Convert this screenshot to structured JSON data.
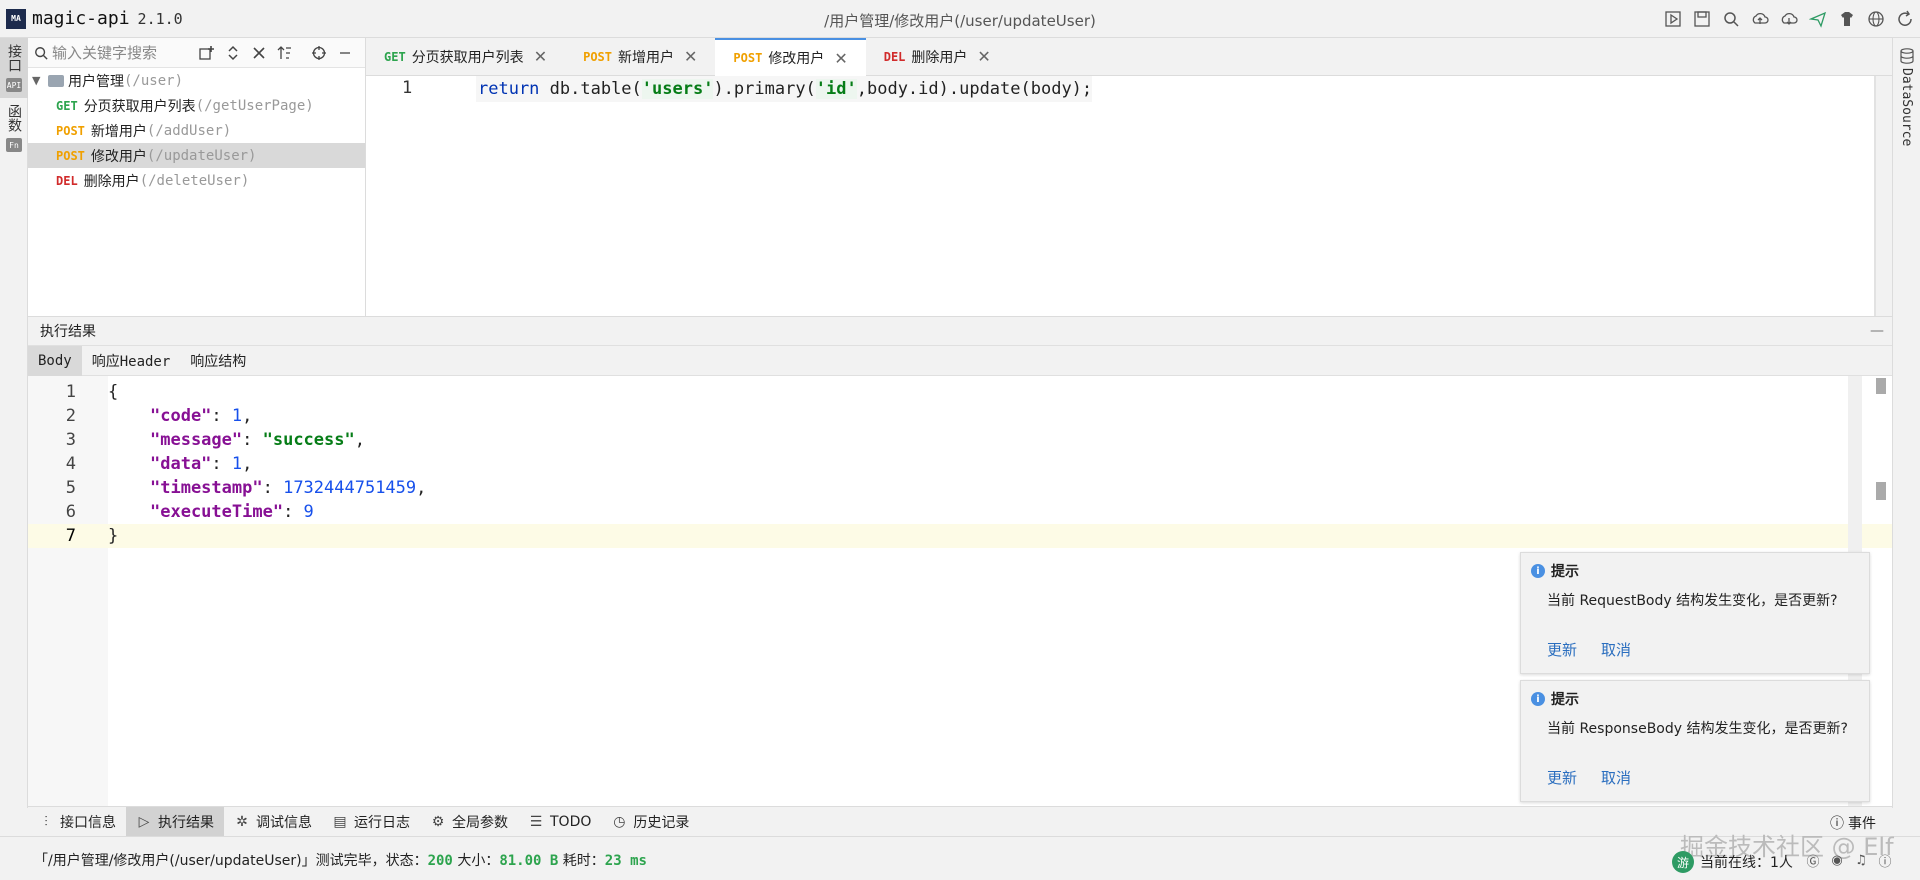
{
  "app": {
    "logo_text": "MA",
    "name": "magic-api",
    "version": "2.1.0",
    "title_path": "/用户管理/修改用户(/user/updateUser)"
  },
  "title_icons": [
    "run-icon",
    "save-icon",
    "search-icon",
    "upload-icon",
    "download-icon",
    "send-icon",
    "skin-icon",
    "globe-icon",
    "refresh-icon"
  ],
  "left_tabs": [
    {
      "label": "接口",
      "badge": "API"
    },
    {
      "label": "函数",
      "badge": "Fn"
    }
  ],
  "tree": {
    "search_placeholder": "输入关键字搜索",
    "group": {
      "name": "用户管理",
      "path": "(/user)"
    },
    "items": [
      {
        "method": "GET",
        "name": "分页获取用户列表",
        "path": "(/getUserPage)"
      },
      {
        "method": "POST",
        "name": "新增用户",
        "path": "(/addUser)"
      },
      {
        "method": "POST",
        "name": "修改用户",
        "path": "(/updateUser)"
      },
      {
        "method": "DEL",
        "name": "删除用户",
        "path": "(/deleteUser)"
      }
    ]
  },
  "editor_tabs": [
    {
      "method": "GET",
      "name": "分页获取用户列表"
    },
    {
      "method": "POST",
      "name": "新增用户"
    },
    {
      "method": "POST",
      "name": "修改用户"
    },
    {
      "method": "DEL",
      "name": "删除用户"
    }
  ],
  "editor": {
    "line_number": "1",
    "code": {
      "kw": "return",
      "p1": " db.table(",
      "s1": "'users'",
      "p2": ").primary(",
      "s2": "'id'",
      "p3": ",body.id).update(body);"
    }
  },
  "right_panel": {
    "label": "DataSource"
  },
  "result": {
    "title": "执行结果",
    "minimize": "—",
    "tabs": [
      "Body",
      "响应Header",
      "响应结构"
    ],
    "json_lines": [
      {
        "n": "1",
        "open": "{"
      },
      {
        "n": "2",
        "key": "\"code\"",
        "sep": ": ",
        "num": "1",
        "end": ","
      },
      {
        "n": "3",
        "key": "\"message\"",
        "sep": ": ",
        "str": "\"success\"",
        "end": ","
      },
      {
        "n": "4",
        "key": "\"data\"",
        "sep": ": ",
        "num": "1",
        "end": ","
      },
      {
        "n": "5",
        "key": "\"timestamp\"",
        "sep": ": ",
        "num": "1732444751459",
        "end": ","
      },
      {
        "n": "6",
        "key": "\"executeTime\"",
        "sep": ": ",
        "num": "9",
        "end": ""
      },
      {
        "n": "7",
        "open": "}"
      }
    ]
  },
  "notices": [
    {
      "title": "提示",
      "body": "当前 RequestBody 结构发生变化，是否更新?",
      "update": "更新",
      "cancel": "取消"
    },
    {
      "title": "提示",
      "body": "当前 ResponseBody 结构发生变化，是否更新?",
      "update": "更新",
      "cancel": "取消"
    }
  ],
  "tool_tabs": [
    {
      "icon": "interface-info-icon",
      "glyph": "⫶",
      "label": "接口信息"
    },
    {
      "icon": "play-icon",
      "glyph": "▷",
      "label": "执行结果"
    },
    {
      "icon": "bug-icon",
      "glyph": "✲",
      "label": "调试信息"
    },
    {
      "icon": "log-icon",
      "glyph": "▤",
      "label": "运行日志"
    },
    {
      "icon": "gear-icon",
      "glyph": "⚙",
      "label": "全局参数"
    },
    {
      "icon": "list-icon",
      "glyph": "☰",
      "label": "TODO"
    },
    {
      "icon": "clock-icon",
      "glyph": "◷",
      "label": "历史记录"
    }
  ],
  "events_label": "事件",
  "status": {
    "prefix": "「/用户管理/修改用户(/user/updateUser)」测试完毕，状态：",
    "status_code": "200",
    "size_label": " 大小：",
    "size": "81.00 B",
    "time_label": " 耗时：",
    "time": "23 ms",
    "watermark": "掘金技术社区 @ Elf",
    "online_badge": "游",
    "online_text": "当前在线：1人"
  },
  "colors": {
    "get": "#2da44e",
    "post": "#f0a000",
    "del": "#d12b2b",
    "accent": "#4a90e2"
  }
}
